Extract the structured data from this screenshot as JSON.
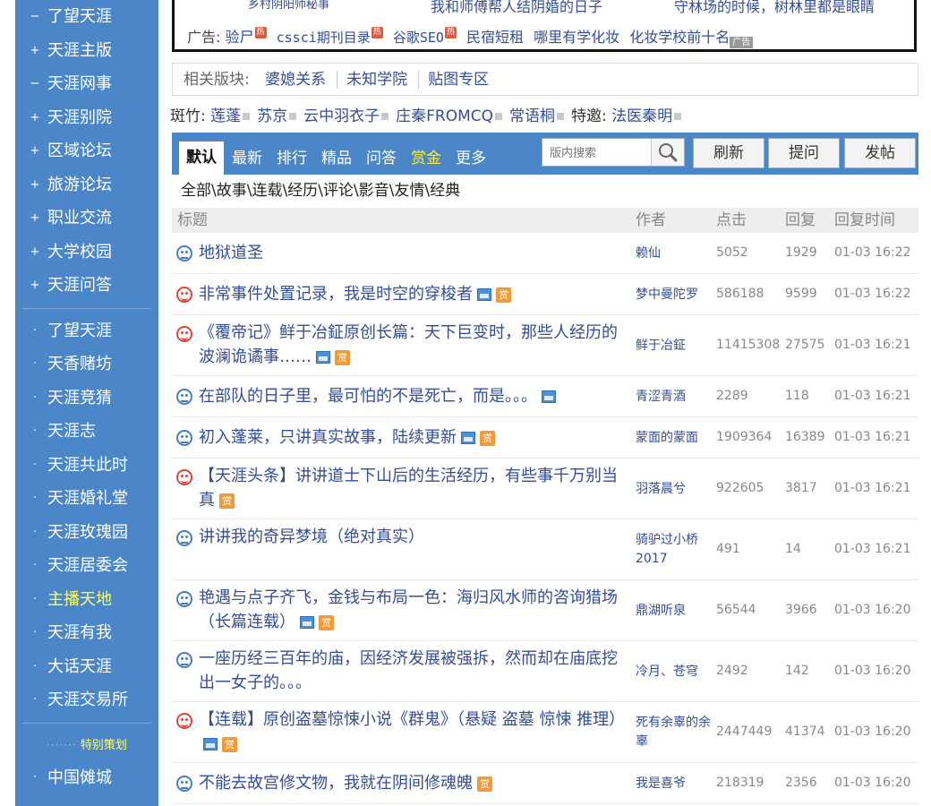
{
  "sidebar": {
    "group1": [
      {
        "label": "了望天涯",
        "bullet": "−"
      },
      {
        "label": "天涯主版",
        "bullet": "+"
      },
      {
        "label": "天涯网事",
        "bullet": "−"
      },
      {
        "label": "天涯别院",
        "bullet": "+"
      },
      {
        "label": "区域论坛",
        "bullet": "+"
      },
      {
        "label": "旅游论坛",
        "bullet": "+"
      },
      {
        "label": "职业交流",
        "bullet": "+"
      },
      {
        "label": "大学校园",
        "bullet": "+"
      },
      {
        "label": "天涯问答",
        "bullet": "+"
      }
    ],
    "group2": [
      {
        "label": "了望天涯",
        "bullet": "·"
      },
      {
        "label": "天香赌坊",
        "bullet": "·"
      },
      {
        "label": "天涯竞猜",
        "bullet": "·"
      },
      {
        "label": "天涯志",
        "bullet": "·"
      },
      {
        "label": "天涯共此时",
        "bullet": "·"
      },
      {
        "label": "天涯婚礼堂",
        "bullet": "·"
      },
      {
        "label": "天涯玫瑰园",
        "bullet": "·"
      },
      {
        "label": "天涯居委会",
        "bullet": "·"
      },
      {
        "label": "主播天地",
        "bullet": "·",
        "highlight": true
      },
      {
        "label": "天涯有我",
        "bullet": "·"
      },
      {
        "label": "大话天涯",
        "bullet": "·"
      },
      {
        "label": "天涯交易所",
        "bullet": "·"
      }
    ],
    "special_label": "特别策划",
    "group3": [
      {
        "label": "中国傩城",
        "bullet": "·"
      }
    ]
  },
  "ad": {
    "row1": [
      "乡村阴阳师秘事",
      "我和师傅帮人结阴婚的日子",
      "守林场的时候，树林里都是眼睛"
    ],
    "prefix": "广告:",
    "links": [
      "验尸",
      "cssci期刊目录",
      "谷歌SEO",
      "民宿短租",
      "哪里有学化妆",
      "化妆学校前十名"
    ],
    "hot_badge": "热",
    "ad_tag": "广告"
  },
  "related": {
    "label": "相关版块:",
    "links": [
      "婆媳关系",
      "未知学院",
      "贴图专区"
    ]
  },
  "moderators": {
    "label": "斑竹:",
    "names": [
      "莲蓬",
      "苏京",
      "云中羽衣子",
      "庄秦FROMCQ",
      "常语桐"
    ],
    "guest_label": "特邀:",
    "guests": [
      "法医秦明"
    ]
  },
  "tabs": [
    "默认",
    "最新",
    "排行",
    "精品",
    "问答",
    "赏金",
    "更多"
  ],
  "search": {
    "placeholder": "版内搜索"
  },
  "buttons": {
    "refresh": "刷新",
    "ask": "提问",
    "post": "发帖"
  },
  "categories": "全部\\故事\\连载\\经历\\评论\\影音\\友情\\经典",
  "table": {
    "headers": {
      "title": "标题",
      "author": "作者",
      "clicks": "点击",
      "replies": "回复",
      "time": "回复时间"
    },
    "reward_badge": "赏",
    "rows": [
      {
        "face": "blue",
        "title": "地狱道圣",
        "pic": false,
        "reward": false,
        "author": "赖仙",
        "clicks": "5052",
        "replies": "1929",
        "time": "01-03 16:22"
      },
      {
        "face": "red",
        "title": "非常事件处置记录，我是时空的穿梭者",
        "pic": true,
        "reward": true,
        "author": "梦中曼陀罗",
        "clicks": "586188",
        "replies": "9599",
        "time": "01-03 16:22"
      },
      {
        "face": "red",
        "title": "《覆帝记》鲜于冶鉦原创长篇：天下巨变时，那些人经历的波澜诡谲事……",
        "pic": true,
        "reward": true,
        "author": "鲜于冶鉦",
        "clicks": "11415308",
        "replies": "27575",
        "time": "01-03 16:21"
      },
      {
        "face": "blue",
        "title": "在部队的日子里，最可怕的不是死亡，而是。。。",
        "pic": true,
        "reward": false,
        "author": "青涩青酒",
        "clicks": "2289",
        "replies": "118",
        "time": "01-03 16:21"
      },
      {
        "face": "blue",
        "title": "初入蓬莱，只讲真实故事，陆续更新",
        "pic": true,
        "reward": true,
        "author": "蒙面的蒙面",
        "clicks": "1909364",
        "replies": "16389",
        "time": "01-03 16:21"
      },
      {
        "face": "red",
        "title": "【天涯头条】讲讲道士下山后的生活经历，有些事千万别当真",
        "pic": false,
        "reward": true,
        "author": "羽落晨兮",
        "clicks": "922605",
        "replies": "3817",
        "time": "01-03 16:21"
      },
      {
        "face": "blue",
        "title": "讲讲我的奇异梦境（绝对真实）",
        "pic": false,
        "reward": false,
        "author": "骑驴过小桥2017",
        "clicks": "491",
        "replies": "14",
        "time": "01-03 16:21"
      },
      {
        "face": "blue",
        "title": "艳遇与点子齐飞，金钱与布局一色：海归风水师的咨询猎场（长篇连载）",
        "pic": true,
        "reward": true,
        "author": "鼎湖听泉",
        "clicks": "56544",
        "replies": "3966",
        "time": "01-03 16:20"
      },
      {
        "face": "blue",
        "title": "一座历经三百年的庙，因经济发展被强拆，然而却在庙底挖出一女子的。。。",
        "pic": false,
        "reward": false,
        "author": "冷月、苍穹",
        "clicks": "2492",
        "replies": "142",
        "time": "01-03 16:20"
      },
      {
        "face": "red",
        "title": "【连载】原创盗墓惊悚小说《群鬼》（悬疑 盗墓 惊悚 推理）",
        "pic": true,
        "reward": true,
        "author": "死有余辜的余辜",
        "clicks": "2447449",
        "replies": "41374",
        "time": "01-03 16:20"
      },
      {
        "face": "blue",
        "title": "不能去故宫修文物，我就在阴间修魂魄",
        "pic": false,
        "reward": true,
        "author": "我是喜爷",
        "clicks": "218319",
        "replies": "2356",
        "time": "01-03 16:20"
      }
    ]
  }
}
